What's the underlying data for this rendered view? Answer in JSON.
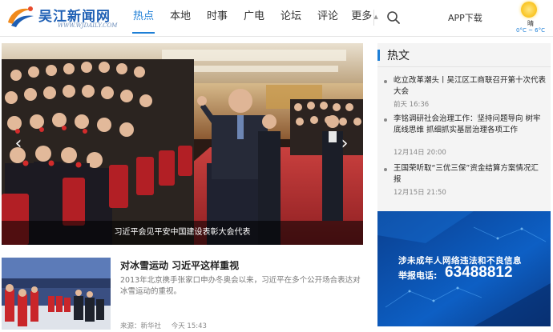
{
  "brand": {
    "name": "吴江新闻网",
    "url": "WWW.WJDAILY.COM",
    "color": "#1e5fb4"
  },
  "nav": {
    "items": [
      {
        "label": "热点",
        "active": true
      },
      {
        "label": "本地"
      },
      {
        "label": "时事"
      },
      {
        "label": "广电"
      },
      {
        "label": "论坛"
      },
      {
        "label": "评论"
      },
      {
        "label": "更多"
      }
    ],
    "accent": "#1e7fd6"
  },
  "header": {
    "search_icon": "search-icon",
    "app_download": "APP下载",
    "weather": {
      "icon": "sun-icon",
      "condition": "晴",
      "temperature": "0°C ~ 6°C"
    }
  },
  "hero": {
    "caption": "习近平会见平安中国建设表彰大会代表",
    "prev_icon": "chevron-left-icon",
    "next_icon": "chevron-right-icon"
  },
  "hot": {
    "title": "热文",
    "items": [
      {
        "title": "屹立改革潮头丨吴江区工商联召开第十次代表大会",
        "time": "前天 16:36"
      },
      {
        "title": "李铭调研社会治理工作：坚持问题导向 树牢底线思维 抓细抓实基层治理各项工作",
        "time": "12月14日 20:00"
      },
      {
        "title": "王国荣听取“三优三保”资金结算方案情况汇报",
        "time": "12月15日 21:50"
      }
    ]
  },
  "ad": {
    "line1": "涉未成年人网络违法和不良信息",
    "line2": "举报电话:",
    "phone": "63488812"
  },
  "article": {
    "title": "对冰雪运动 习近平这样重视",
    "summary": "2013年北京携手张家口申办冬奥会以来，习近平在多个公开场合表达对冰雪运动的重视。",
    "source": "来源：新华社",
    "time": "今天 15:43"
  }
}
